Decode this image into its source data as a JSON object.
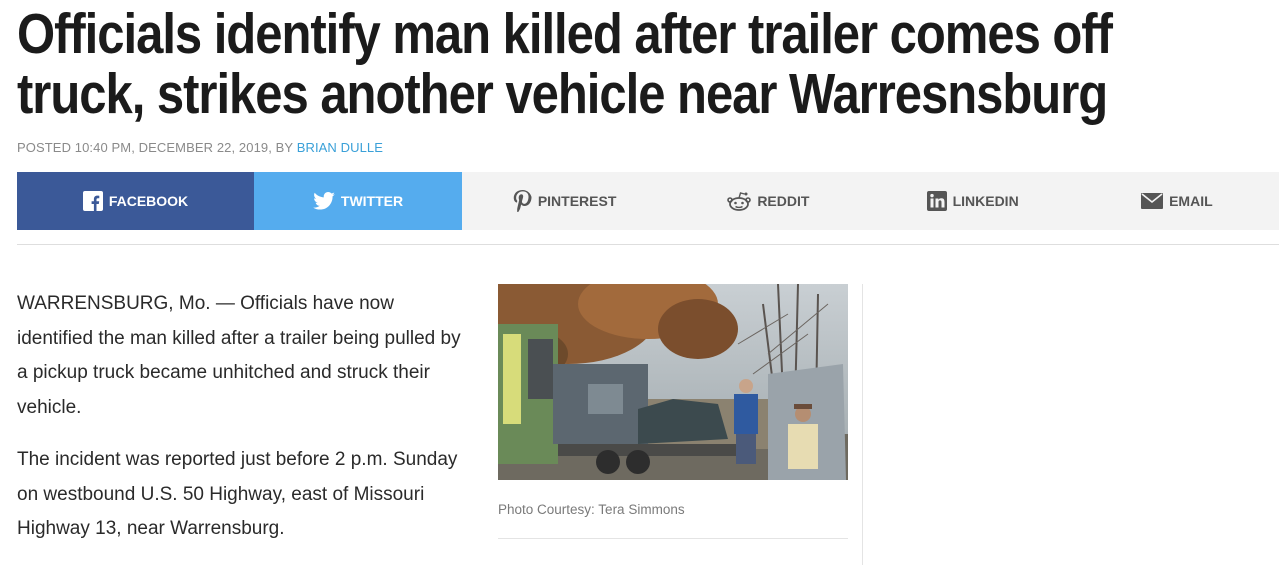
{
  "article": {
    "headline_line1": "Officials identify man killed after trailer comes off",
    "headline_line2": "truck, strikes another vehicle near Warresnsburg",
    "byline_prefix": "POSTED 10:40 PM, DECEMBER 22, 2019, BY",
    "author": "BRIAN DULLE",
    "paragraphs": [
      "WARRENSBURG, Mo. — Officials have now identified the man killed after a trailer being pulled by a pickup truck became unhitched and struck their vehicle.",
      "The incident was reported just before 2 p.m. Sunday on westbound U.S. 50 Highway, east of Missouri Highway 13, near Warrensburg."
    ]
  },
  "share": {
    "facebook": {
      "label": "FACEBOOK",
      "icon": "facebook-icon",
      "color": "#3b5998"
    },
    "twitter": {
      "label": "TWITTER",
      "icon": "twitter-icon",
      "color": "#55acee"
    },
    "pinterest": {
      "label": "PINTEREST",
      "icon": "pinterest-icon"
    },
    "reddit": {
      "label": "REDDIT",
      "icon": "reddit-icon"
    },
    "linkedin": {
      "label": "LINKEDIN",
      "icon": "linkedin-icon"
    },
    "email": {
      "label": "EMAIL",
      "icon": "email-icon"
    }
  },
  "photo": {
    "caption": "Photo Courtesy: Tera Simmons"
  },
  "colors": {
    "author_link": "#3aa0d8",
    "share_bar_bg": "#f3f3f3"
  }
}
